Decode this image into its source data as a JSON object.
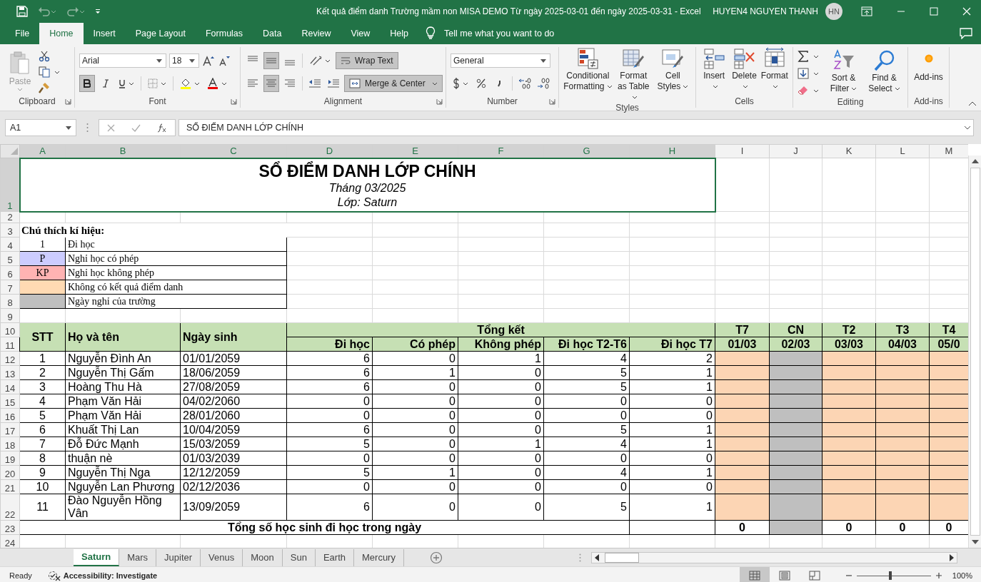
{
  "window": {
    "title": "Kết quả điểm danh Trường mầm non MISA DEMO Từ ngày 2025-03-01 đến ngày 2025-03-31  -  Excel",
    "user": "HUYEN4 NGUYEN THANH",
    "user_initials": "HN"
  },
  "ribbon_tabs": [
    {
      "label": "File",
      "selected": false
    },
    {
      "label": "Home",
      "selected": true
    },
    {
      "label": "Insert",
      "selected": false
    },
    {
      "label": "Page Layout",
      "selected": false
    },
    {
      "label": "Formulas",
      "selected": false
    },
    {
      "label": "Data",
      "selected": false
    },
    {
      "label": "Review",
      "selected": false
    },
    {
      "label": "View",
      "selected": false
    },
    {
      "label": "Help",
      "selected": false
    }
  ],
  "tell_me": "Tell me what you want to do",
  "ribbon_groups": [
    {
      "kind": "clipboard",
      "label": "Clipboard",
      "paste": "Paste"
    },
    {
      "kind": "font",
      "label": "Font",
      "font_name": "Arial",
      "font_size": "18",
      "bold": true
    },
    {
      "kind": "alignment",
      "label": "Alignment",
      "wrap_text": "Wrap Text",
      "merge": "Merge & Center",
      "wrap_on": true,
      "merge_on": true,
      "middle_on": true,
      "center_on": true
    },
    {
      "kind": "number",
      "label": "Number",
      "format": "General"
    },
    {
      "kind": "styles",
      "label": "Styles",
      "buttons": [
        {
          "kind": "conditional",
          "label": "Conditional Formatting"
        },
        {
          "kind": "table",
          "label": "Format as Table"
        },
        {
          "kind": "cell-styles",
          "label": "Cell Styles"
        }
      ]
    },
    {
      "kind": "cells",
      "label": "Cells",
      "buttons": [
        {
          "kind": "insert",
          "label": "Insert"
        },
        {
          "kind": "delete",
          "label": "Delete"
        },
        {
          "kind": "format",
          "label": "Format"
        }
      ]
    },
    {
      "kind": "editing",
      "label": "Editing",
      "buttons": [
        {
          "kind": "sort",
          "label": "Sort & Filter"
        },
        {
          "kind": "find",
          "label": "Find & Select"
        }
      ]
    },
    {
      "kind": "addins",
      "label": "Add-ins",
      "buttons": [
        {
          "kind": "addins",
          "label": "Add-ins"
        }
      ]
    }
  ],
  "formula_bar": {
    "name_box": "A1",
    "formula": "SỔ ĐIỂM DANH LỚP CHÍNH"
  },
  "columns": [
    {
      "label": "A",
      "selected": true
    },
    {
      "label": "B",
      "selected": true
    },
    {
      "label": "C",
      "selected": true
    },
    {
      "label": "D",
      "selected": true
    },
    {
      "label": "E",
      "selected": true
    },
    {
      "label": "F",
      "selected": true
    },
    {
      "label": "G",
      "selected": true
    },
    {
      "label": "H",
      "selected": true
    },
    {
      "label": "I",
      "selected": false
    },
    {
      "label": "J",
      "selected": false
    },
    {
      "label": "K",
      "selected": false
    },
    {
      "label": "L",
      "selected": false
    },
    {
      "label": "M",
      "selected": false
    }
  ],
  "row_numbers": [
    {
      "label": "1",
      "selected": true
    },
    {
      "label": "2",
      "selected": false
    },
    {
      "label": "3",
      "selected": false
    },
    {
      "label": "4",
      "selected": false
    },
    {
      "label": "5",
      "selected": false
    },
    {
      "label": "6",
      "selected": false
    },
    {
      "label": "7",
      "selected": false
    },
    {
      "label": "8",
      "selected": false
    },
    {
      "label": "9",
      "selected": false
    },
    {
      "label": "10",
      "selected": false
    },
    {
      "label": "11",
      "selected": false
    },
    {
      "label": "12",
      "selected": false
    },
    {
      "label": "13",
      "selected": false
    },
    {
      "label": "14",
      "selected": false
    },
    {
      "label": "15",
      "selected": false
    },
    {
      "label": "16",
      "selected": false
    },
    {
      "label": "17",
      "selected": false
    },
    {
      "label": "18",
      "selected": false
    },
    {
      "label": "19",
      "selected": false
    },
    {
      "label": "20",
      "selected": false
    },
    {
      "label": "21",
      "selected": false
    },
    {
      "label": "22",
      "selected": false
    },
    {
      "label": "23",
      "selected": false
    },
    {
      "label": "24",
      "selected": false
    }
  ],
  "sheet": {
    "title": "SỔ ĐIỂM DANH LỚP CHÍNH",
    "month": "Tháng 03/2025",
    "class_line": "Lớp: Saturn",
    "legend_heading": "Chú thích kí hiệu:",
    "legend": [
      {
        "code": "1",
        "description": "Đi học",
        "color": "#ffffff"
      },
      {
        "code": "P",
        "description": "Nghỉ học có phép",
        "color": "#ccccff"
      },
      {
        "code": "KP",
        "description": "Nghỉ học không phép",
        "color": "#ffb3b3"
      },
      {
        "description": "Không có kết quả điểm danh",
        "color": "#ffdab3"
      },
      {
        "description": "Ngày nghỉ của trường",
        "color": "#bfbfbf"
      }
    ],
    "headers": {
      "stt": "STT",
      "name": "Họ và tên",
      "dob": "Ngày sinh",
      "summary": "Tổng kết",
      "summary_columns": [
        "Đi học",
        "Có phép",
        "Không phép",
        "Đi học T2-T6",
        "Đi học T7"
      ]
    },
    "days": [
      {
        "weekday": "T7",
        "date": "01/03",
        "kind": "no-result",
        "total": "0"
      },
      {
        "weekday": "CN",
        "date": "02/03",
        "kind": "holiday"
      },
      {
        "weekday": "T2",
        "date": "03/03",
        "kind": "no-result",
        "total": "0"
      },
      {
        "weekday": "T3",
        "date": "04/03",
        "kind": "no-result",
        "total": "0"
      },
      {
        "weekday": "T4",
        "date": "05/0",
        "kind": "no-result",
        "total": "0"
      }
    ],
    "students": [
      {
        "stt": "1",
        "name": "Nguyễn Đình An",
        "dob": "01/01/2059",
        "counts": [
          "6",
          "0",
          "1",
          "4",
          "2"
        ]
      },
      {
        "stt": "2",
        "name": "Nguyễn Thị Gấm",
        "dob": "18/06/2059",
        "counts": [
          "6",
          "1",
          "0",
          "5",
          "1"
        ]
      },
      {
        "stt": "3",
        "name": "Hoàng Thu Hà",
        "dob": "27/08/2059",
        "counts": [
          "6",
          "0",
          "0",
          "5",
          "1"
        ]
      },
      {
        "stt": "4",
        "name": "Phạm Văn Hải",
        "dob": "04/02/2060",
        "counts": [
          "0",
          "0",
          "0",
          "0",
          "0"
        ]
      },
      {
        "stt": "5",
        "name": "Phạm Văn Hải",
        "dob": "28/01/2060",
        "counts": [
          "0",
          "0",
          "0",
          "0",
          "0"
        ]
      },
      {
        "stt": "6",
        "name": "Khuất Thị Lan",
        "dob": "10/04/2059",
        "counts": [
          "6",
          "0",
          "0",
          "5",
          "1"
        ]
      },
      {
        "stt": "7",
        "name": "Đỗ Đức Mạnh",
        "dob": "15/03/2059",
        "counts": [
          "5",
          "0",
          "1",
          "4",
          "1"
        ]
      },
      {
        "stt": "8",
        "name": "thuận nè",
        "dob": "01/03/2039",
        "counts": [
          "0",
          "0",
          "0",
          "0",
          "0"
        ]
      },
      {
        "stt": "9",
        "name": "Nguyễn Thị Nga",
        "dob": "12/12/2059",
        "counts": [
          "5",
          "1",
          "0",
          "4",
          "1"
        ]
      },
      {
        "stt": "10",
        "name": "Nguyễn Lan Phương",
        "dob": "02/12/2036",
        "counts": [
          "0",
          "0",
          "0",
          "0",
          "0"
        ]
      },
      {
        "stt": "11",
        "name": "Đào Nguyễn Hồng Vân",
        "dob": "13/09/2059",
        "counts": [
          "6",
          "0",
          "0",
          "5",
          "1"
        ]
      }
    ],
    "total_label": "Tổng số học sinh đi học trong ngày"
  },
  "sheet_tabs": [
    {
      "label": "Saturn",
      "selected": true
    },
    {
      "label": "Mars",
      "selected": false
    },
    {
      "label": "Jupiter",
      "selected": false
    },
    {
      "label": "Venus",
      "selected": false
    },
    {
      "label": "Moon",
      "selected": false
    },
    {
      "label": "Sun",
      "selected": false
    },
    {
      "label": "Earth",
      "selected": false
    },
    {
      "label": "Mercury",
      "selected": false
    }
  ],
  "status": {
    "ready": "Ready",
    "accessibility": "Accessibility: Investigate",
    "zoom": "100%",
    "zoom_slider": {
      "level": 0.45
    },
    "views": [
      {
        "kind": "normal",
        "selected": true
      },
      {
        "kind": "page-layout",
        "selected": false
      },
      {
        "kind": "page-break",
        "selected": false
      }
    ]
  }
}
